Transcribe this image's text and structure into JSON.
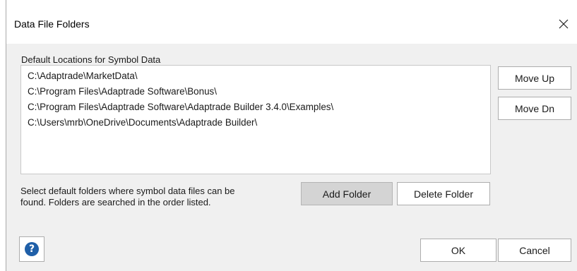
{
  "window": {
    "title": "Data File Folders",
    "close_icon": "close-icon"
  },
  "locations": {
    "label": "Default Locations for Symbol Data",
    "items": [
      "C:\\Adaptrade\\MarketData\\",
      "C:\\Program Files\\Adaptrade Software\\Bonus\\",
      "C:\\Program Files\\Adaptrade Software\\Adaptrade Builder 3.4.0\\Examples\\",
      "C:\\Users\\mrb\\OneDrive\\Documents\\Adaptrade Builder\\"
    ]
  },
  "side_buttons": {
    "move_up": "Move Up",
    "move_down": "Move Dn"
  },
  "folder_buttons": {
    "add": "Add Folder",
    "delete": "Delete Folder"
  },
  "help": {
    "text": "Select default folders where symbol data files can be found. Folders are searched in the order listed.",
    "icon": "help-icon",
    "glyph": "?"
  },
  "footer": {
    "ok": "OK",
    "cancel": "Cancel"
  },
  "colors": {
    "dialog_bg": "#f0f0f0",
    "help_icon": "#1f5fa8",
    "pressed_button": "#d4d4d4"
  }
}
